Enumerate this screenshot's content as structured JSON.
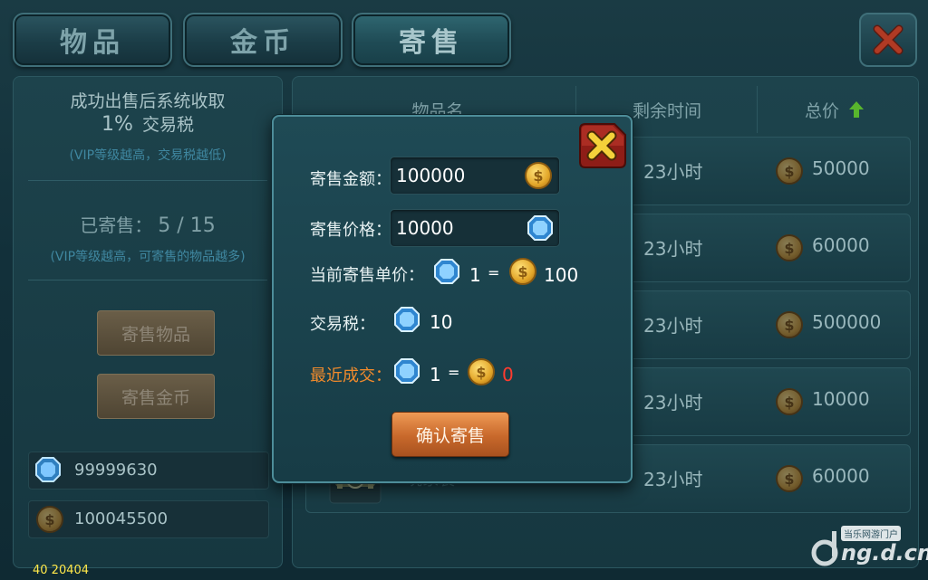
{
  "tabs": [
    {
      "label": "物品"
    },
    {
      "label": "金币"
    },
    {
      "label": "寄售"
    }
  ],
  "left_panel": {
    "tax_line1": "成功出售后系统收取",
    "tax_percent": "1%",
    "tax_label": "交易税",
    "tax_note": "(VIP等级越高，交易税越低)",
    "sold_label": "已寄售：",
    "sold_count": "5 / 15",
    "sold_note": "(VIP等级越高，可寄售的物品越多)",
    "btn_sell_item": "寄售物品",
    "btn_sell_gold": "寄售金币",
    "gem_balance": "99999630",
    "gold_balance": "100045500"
  },
  "table": {
    "headers": {
      "name": "物品名",
      "time": "剩余时间",
      "price": "总价"
    },
    "rows": [
      {
        "time": "23小时",
        "price": "50000"
      },
      {
        "time": "23小时",
        "price": "60000"
      },
      {
        "time": "23小时",
        "price": "500000"
      },
      {
        "time": "23小时",
        "price": "10000"
      },
      {
        "time": "23小时",
        "price": "60000",
        "name": "玩家装"
      }
    ]
  },
  "dialog": {
    "amount_label": "寄售金额：",
    "amount_value": "100000",
    "price_label": "寄售价格：",
    "price_value": "10000",
    "unit_label": "当前寄售单价：",
    "unit_left": "1",
    "unit_eq": "=",
    "unit_right": "100",
    "tax_label": "交易税：",
    "tax_value": "10",
    "recent_label": "最近成交：",
    "recent_left": "1",
    "recent_eq": "=",
    "recent_right": "0",
    "confirm": "确认寄售"
  },
  "footer": {
    "debug": "40 20404"
  },
  "watermark": {
    "site": "当乐网游门户",
    "domain": "ng.d.cn"
  },
  "colors": {
    "accent_orange": "#f08a2c",
    "recent_zero": "#ff3b2f"
  }
}
